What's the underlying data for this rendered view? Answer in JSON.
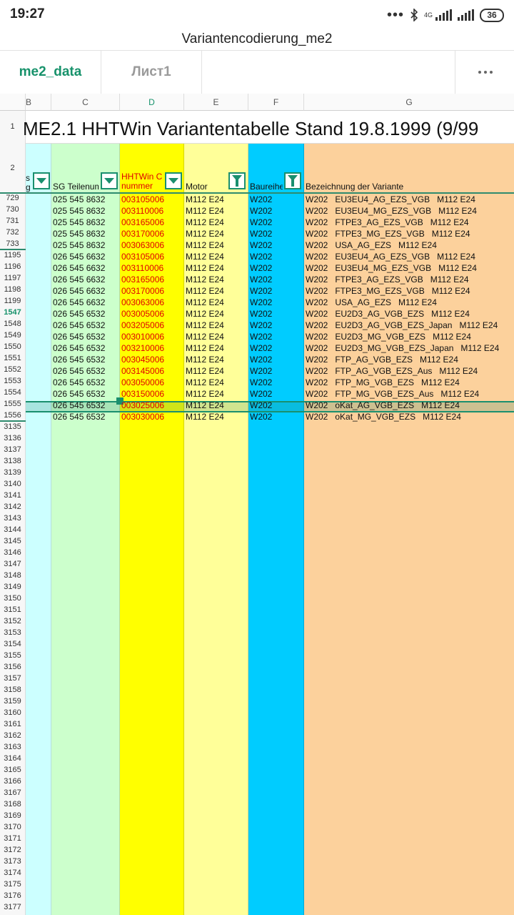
{
  "status_bar": {
    "time": "19:27",
    "network": "4G",
    "battery": "36"
  },
  "app": {
    "title": "Variantencodierung_me2"
  },
  "tabs": [
    {
      "label": "me2_data",
      "active": true
    },
    {
      "label": "Лист1",
      "active": false
    }
  ],
  "columns": [
    "B",
    "C",
    "D",
    "E",
    "F",
    "G"
  ],
  "selected_column": "D",
  "sheet_title": "ME2.1   HHTWin Variantentabelle Stand 19.8.1999 (9/99",
  "header_row": {
    "b": "s\ng",
    "c": "SG Teilenum",
    "d": "HHTWin C\nnummer",
    "e": "Motor",
    "f": "Baureihe",
    "g": "Bezeichnung  der Variante"
  },
  "header_row_labels": [
    "1",
    "2"
  ],
  "data_rows": [
    {
      "n": "729",
      "c": "025 545 8632",
      "d": "003105006",
      "e": "M112 E24",
      "f": "W202",
      "g": "W202   EU3EU4_AG_EZS_VGB   M112 E24"
    },
    {
      "n": "730",
      "c": "025 545 8632",
      "d": "003110006",
      "e": "M112 E24",
      "f": "W202",
      "g": "W202   EU3EU4_MG_EZS_VGB   M112 E24"
    },
    {
      "n": "731",
      "c": "025 545 8632",
      "d": "003165006",
      "e": "M112 E24",
      "f": "W202",
      "g": "W202   FTPE3_AG_EZS_VGB   M112 E24"
    },
    {
      "n": "732",
      "c": "025 545 8632",
      "d": "003170006",
      "e": "M112 E24",
      "f": "W202",
      "g": "W202   FTPE3_MG_EZS_VGB   M112 E24"
    },
    {
      "n": "733",
      "c": "025 545 8632",
      "d": "003063006",
      "e": "M112 E24",
      "f": "W202",
      "g": "W202   USA_AG_EZS   M112 E24"
    },
    {
      "n": "1195",
      "c": "026 545 6632",
      "d": "003105006",
      "e": "M112 E24",
      "f": "W202",
      "g": "W202   EU3EU4_AG_EZS_VGB   M112 E24"
    },
    {
      "n": "1196",
      "c": "026 545 6632",
      "d": "003110006",
      "e": "M112 E24",
      "f": "W202",
      "g": "W202   EU3EU4_MG_EZS_VGB   M112 E24"
    },
    {
      "n": "1197",
      "c": "026 545 6632",
      "d": "003165006",
      "e": "M112 E24",
      "f": "W202",
      "g": "W202   FTPE3_AG_EZS_VGB   M112 E24"
    },
    {
      "n": "1198",
      "c": "026 545 6632",
      "d": "003170006",
      "e": "M112 E24",
      "f": "W202",
      "g": "W202   FTPE3_MG_EZS_VGB   M112 E24"
    },
    {
      "n": "1199",
      "c": "026 545 6632",
      "d": "003063006",
      "e": "M112 E24",
      "f": "W202",
      "g": "W202   USA_AG_EZS   M112 E24"
    },
    {
      "n": "1547",
      "c": "026 545 6532",
      "d": "003005006",
      "e": "M112 E24",
      "f": "W202",
      "g": "W202   EU2D3_AG_VGB_EZS   M112 E24",
      "selected": true
    },
    {
      "n": "1548",
      "c": "026 545 6532",
      "d": "003205006",
      "e": "M112 E24",
      "f": "W202",
      "g": "W202   EU2D3_AG_VGB_EZS_Japan   M112 E24"
    },
    {
      "n": "1549",
      "c": "026 545 6532",
      "d": "003010006",
      "e": "M112 E24",
      "f": "W202",
      "g": "W202   EU2D3_MG_VGB_EZS   M112 E24"
    },
    {
      "n": "1550",
      "c": "026 545 6532",
      "d": "003210006",
      "e": "M112 E24",
      "f": "W202",
      "g": "W202   EU2D3_MG_VGB_EZS_Japan   M112 E24"
    },
    {
      "n": "1551",
      "c": "026 545 6532",
      "d": "003045006",
      "e": "M112 E24",
      "f": "W202",
      "g": "W202   FTP_AG_VGB_EZS   M112 E24"
    },
    {
      "n": "1552",
      "c": "026 545 6532",
      "d": "003145006",
      "e": "M112 E24",
      "f": "W202",
      "g": "W202   FTP_AG_VGB_EZS_Aus   M112 E24"
    },
    {
      "n": "1553",
      "c": "026 545 6532",
      "d": "003050006",
      "e": "M112 E24",
      "f": "W202",
      "g": "W202   FTP_MG_VGB_EZS   M112 E24"
    },
    {
      "n": "1554",
      "c": "026 545 6532",
      "d": "003150006",
      "e": "M112 E24",
      "f": "W202",
      "g": "W202   FTP_MG_VGB_EZS_Aus   M112 E24"
    },
    {
      "n": "1555",
      "c": "026 545 6532",
      "d": "003025006",
      "e": "M112 E24",
      "f": "W202",
      "g": "W202   oKat_AG_VGB_EZS   M112 E24"
    },
    {
      "n": "1556",
      "c": "026 545 6532",
      "d": "003030006",
      "e": "M112 E24",
      "f": "W202",
      "g": "W202   oKat_MG_VGB_EZS   M112 E24"
    }
  ],
  "empty_row_numbers": [
    "3135",
    "3136",
    "3137",
    "3138",
    "3139",
    "3140",
    "3141",
    "3142",
    "3143",
    "3144",
    "3145",
    "3146",
    "3147",
    "3148",
    "3149",
    "3150",
    "3151",
    "3152",
    "3153",
    "3154",
    "3155",
    "3156",
    "3157",
    "3158",
    "3159",
    "3160",
    "3161",
    "3162",
    "3163",
    "3164",
    "3165",
    "3166",
    "3167",
    "3168",
    "3169",
    "3170",
    "3171",
    "3172",
    "3173",
    "3174",
    "3175",
    "3176",
    "3177"
  ],
  "colors": {
    "accent": "#17926b",
    "col_b": "#ccffff",
    "col_c": "#ccffcc",
    "col_d": "#ffff00",
    "col_e": "#ffff99",
    "col_f": "#00ccff",
    "col_g": "#fcd19c",
    "code_text": "#e00000"
  },
  "icons": {
    "filter_dropdown": "chevron-down-icon",
    "filter_active": "funnel-icon",
    "more": "more-icon"
  }
}
